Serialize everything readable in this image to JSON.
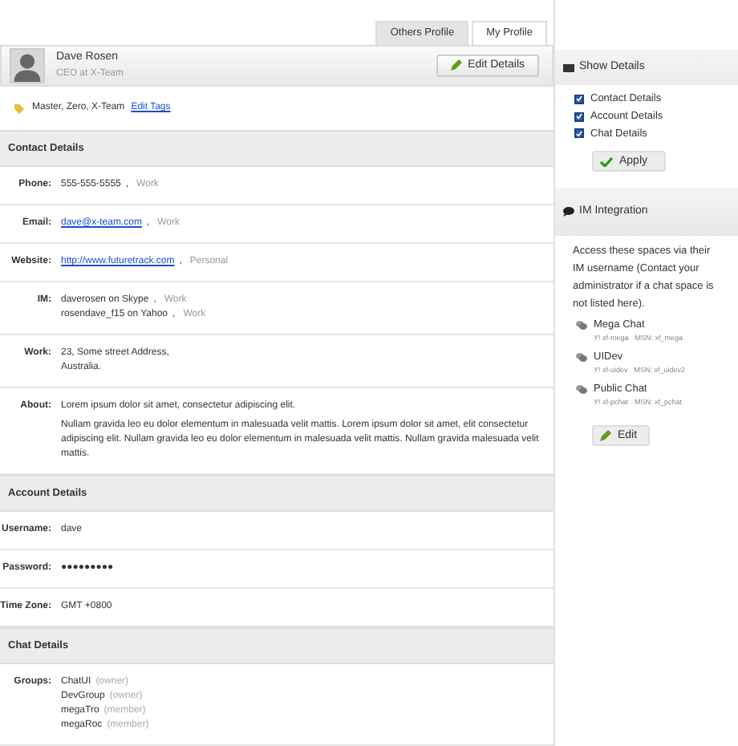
{
  "tabs": [
    {
      "label": "Others Profile",
      "selected": false
    },
    {
      "label": "My Profile",
      "selected": true
    }
  ],
  "profile": {
    "name": "Dave Rosen",
    "title": "CEO at X-Team",
    "edit_button": "Edit Details"
  },
  "tags": {
    "text": "Master, Zero, X-Team",
    "link": "Edit Tags"
  },
  "sections": [
    {
      "title": "Contact Details",
      "rows": [
        {
          "label": "Phone:",
          "lines": [
            {
              "value": "555-555-5555",
              "link": false,
              "sep": ",",
              "type": "Work"
            }
          ]
        },
        {
          "label": "Email:",
          "lines": [
            {
              "value": "dave@x-team.com",
              "link": true,
              "sep": ",",
              "type": "Work"
            }
          ]
        },
        {
          "label": "Website:",
          "lines": [
            {
              "value": "http://www.futuretrack.com",
              "link": true,
              "sep": ",",
              "type": "Personal"
            }
          ]
        },
        {
          "label": "IM:",
          "lines": [
            {
              "value": "daverosen on Skype",
              "link": false,
              "sep": ",",
              "type": "Work"
            },
            {
              "value": "rosendave_f15 on Yahoo",
              "link": false,
              "sep": ",",
              "type": "Work"
            }
          ]
        },
        {
          "label": "Work:",
          "lines": [
            {
              "value": "23, Some street Address,",
              "link": false
            },
            {
              "value": "Australia.",
              "link": false
            }
          ]
        },
        {
          "label": "About:",
          "paragraphs": [
            "Lorem ipsum dolor sit amet, consectetur adipiscing elit.",
            "Nullam gravida leo eu dolor elementum in malesuada velit mattis. Lorem ipsum dolor sit amet, elit consectetur adipiscing elit. Nullam gravida leo eu dolor elementum in malesuada velit mattis.  Nullam gravida malesuada velit mattis."
          ]
        }
      ]
    },
    {
      "title": "Account Details",
      "rows": [
        {
          "label": "Username:",
          "lines": [
            {
              "value": "dave",
              "link": false
            }
          ]
        },
        {
          "label": "Password:",
          "lines": [
            {
              "value": "●●●●●●●●●",
              "link": false
            }
          ]
        },
        {
          "label": "Time Zone:",
          "lines": [
            {
              "value": "GMT +0800",
              "link": false
            }
          ]
        }
      ]
    },
    {
      "title": "Chat Details",
      "rows": [
        {
          "label": "Groups:",
          "lines": [
            {
              "value": "ChatUI",
              "role": "(owner)"
            },
            {
              "value": "DevGroup",
              "role": "(owner)"
            },
            {
              "value": "megaTro",
              "role": "(member)"
            },
            {
              "value": "megaRoc",
              "role": "(member)"
            }
          ]
        }
      ]
    }
  ],
  "show_details": {
    "title": "Show Details",
    "options": [
      {
        "label": "Contact Details",
        "checked": true
      },
      {
        "label": "Account Details",
        "checked": true
      },
      {
        "label": "Chat Details",
        "checked": true
      }
    ],
    "button": "Apply"
  },
  "im_integration": {
    "title": "IM Integration",
    "description": "Access these spaces via their IM username (Contact your administrator if a chat space is not listed here).",
    "spaces": [
      {
        "name": "Mega Chat",
        "yahoo": "Y! xf-mega",
        "msn": "MSN: xf_mega"
      },
      {
        "name": "UIDev",
        "yahoo": "Y! xf-uidev",
        "msn": "MSN: xf_uidev2"
      },
      {
        "name": "Public Chat",
        "yahoo": "Y! xf-pchat",
        "msn": "MSN: xf_pchat"
      }
    ],
    "button": "Edit"
  }
}
